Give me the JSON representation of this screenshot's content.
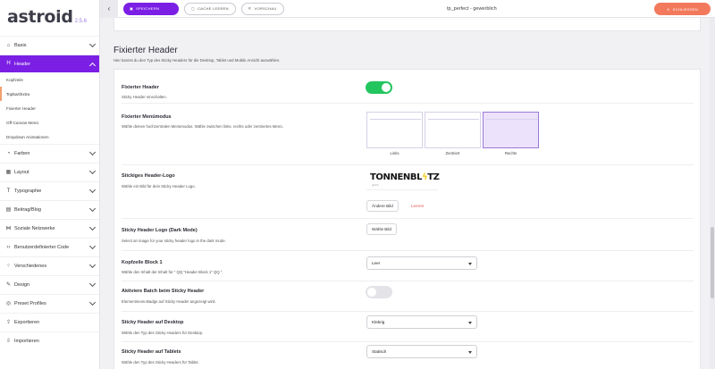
{
  "app": {
    "name": "astroid",
    "version": "2.5.6"
  },
  "sidebar": {
    "items": [
      {
        "label": "Basis",
        "icon": "home-icon",
        "glyph": "⌂"
      },
      {
        "label": "Header",
        "icon": "header-icon",
        "glyph": "H",
        "active": true
      },
      {
        "label": "Farben",
        "icon": "palette-icon",
        "glyph": "◔"
      },
      {
        "label": "Layout",
        "icon": "layout-icon",
        "glyph": "▦"
      },
      {
        "label": "Typographie",
        "icon": "type-icon",
        "glyph": "T"
      },
      {
        "label": "Beitrag/Blog",
        "icon": "blog-icon",
        "glyph": "▤"
      },
      {
        "label": "Soziale Netzwerke",
        "icon": "share-icon",
        "glyph": "⋈"
      },
      {
        "label": "Benutzerdefinierter Code",
        "icon": "code-icon",
        "glyph": "‹›"
      },
      {
        "label": "Verschiedenes",
        "icon": "misc-icon",
        "glyph": "⁘"
      },
      {
        "label": "Design",
        "icon": "brush-icon",
        "glyph": "✎"
      },
      {
        "label": "Preset Profiles",
        "icon": "profiles-icon",
        "glyph": "◎"
      },
      {
        "label": "Exportieren",
        "icon": "export-icon",
        "glyph": "⇪"
      },
      {
        "label": "Importieren",
        "icon": "import-icon",
        "glyph": "⇩"
      }
    ],
    "header_sub": [
      {
        "label": "Kopfzeile"
      },
      {
        "label": "Topbar/Extra",
        "current": true
      },
      {
        "label": "Fixierter Header"
      },
      {
        "label": "Off-Canvas Menü"
      },
      {
        "label": "Dropdown Animationen"
      }
    ]
  },
  "topbar": {
    "save": "SPEICHERN",
    "clear_cache": "CACHE LEEREN",
    "preview": "VORSCHAU",
    "title": "tp_perfect - gewerblich",
    "close": "SCHLIESSEN"
  },
  "section": {
    "title": "Fixierter Header",
    "subtitle": "Hier kannst du den Typ des Sticky Headers für die Desktop, Tablet und Mobile Ansicht auswählen."
  },
  "fields": {
    "sticky_header": {
      "label": "Fixierter Header",
      "desc": "Sticky Header einschalten.",
      "enabled": true
    },
    "menu_mode": {
      "label": "Fixierter Menümodus",
      "desc": "Wähle deinen hochzentralen Menümodus. Wähle zwischen links, rechts oder zentriertes Menü.",
      "options": [
        "Links",
        "Zentriert",
        "Rechts"
      ],
      "selected": "Rechts"
    },
    "sticky_logo": {
      "label": "Stickiges Header-Logo",
      "desc": "Wähle ein Bild für dein Sticky Header Logo.",
      "logo_text": "TONNENBLITZ",
      "logo_sub": "gmbh",
      "change_btn": "Ändere Bild",
      "clear_link": "Leeren"
    },
    "sticky_logo_dark": {
      "label": "Sticky Header Logo (Dark Mode)",
      "desc": "Select an image for your sticky header logo in the dark mode.",
      "choose_btn": "Wähle Bild"
    },
    "header_block1": {
      "label": "Kopfzeile Block 1",
      "desc": "Wähle den Inhalt der Inhalt für \" QQ \"Header Block 1\" QQ \".",
      "value": "Leer"
    },
    "batch_sticky": {
      "label": "Aktiviere Batch beim Sticky Header",
      "desc": "Elementmenü-Badge auf Sticky Header angezeigt wird.",
      "enabled": false
    },
    "sticky_desktop": {
      "label": "Sticky Header auf Desktop",
      "desc": "Wähle den Typ des Sticky Headers für Desktop.",
      "value": "Klebrig"
    },
    "sticky_tablet": {
      "label": "Sticky Header auf Tablets",
      "desc": "Wähle den Typ des Sticky Headers für Tablet.",
      "value": "Statisch"
    }
  }
}
